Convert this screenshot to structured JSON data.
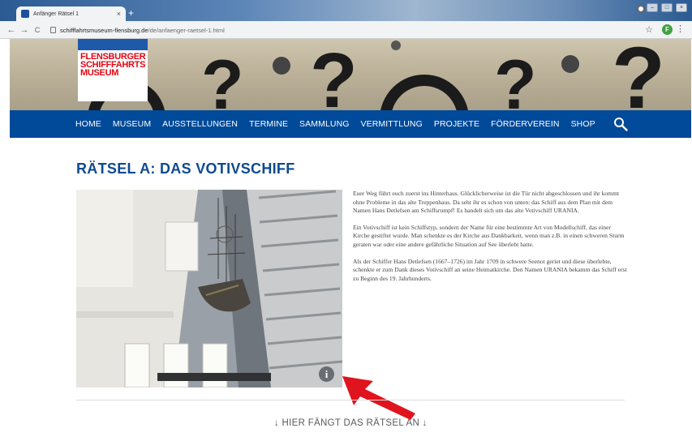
{
  "browser": {
    "tab_title": "Anfänger Rätsel 1",
    "tab_close": "×",
    "new_tab": "+",
    "url_domain": "schifffahrtsmuseum-flensburg.de",
    "url_path": "/de/anfaenger-raetsel-1.html",
    "profile_initial": "F",
    "back": "←",
    "forward": "→",
    "reload": "C",
    "star": "☆",
    "menu": "⋮"
  },
  "logo": {
    "line1": "FLENSBURGER",
    "line2": "SCHIFFFAHRTS",
    "line3": "MUSEUM",
    "brand_red": "#e30613",
    "brand_blue": "#1e5aa8"
  },
  "nav": {
    "items": [
      "HOME",
      "MUSEUM",
      "AUSSTELLUNGEN",
      "TERMINE",
      "SAMMLUNG",
      "VERMITTLUNG",
      "PROJEKTE",
      "FÖRDERVEREIN",
      "SHOP"
    ],
    "background": "#004a99"
  },
  "main": {
    "title": "RÄTSEL A: DAS VOTIVSCHIFF",
    "info_icon": "i",
    "paragraphs": [
      "Euer Weg führt euch zuerst ins Hinterhaus. Glücklicherweise ist die Tür nicht abgeschlossen und ihr kommt ohne Probleme in das alte Treppenhaus. Da seht ihr es schon von unten: das Schiff aus dem Plan mit dem Namen Hans Detlefsen am Schiffsrumpf! Es handelt sich um das alte Votivschiff URANIA.",
      "Ein Votivschiff ist kein Schiffstyp, sondern der Name für eine bestimmte Art von Modellschiff, das einer Kirche gestiftet wurde. Man schenkte es der Kirche aus Dankbarkeit, wenn man z.B. in einen schweren Sturm geraten war oder eine andere gefährliche Situation auf See überlebt hatte.",
      "Als der Schiffer Hans Detlefsen (1667–1726) im Jahr 1709 in schwere Seenot geriet und diese überlebte, schenkte er zum Dank dieses Votivschiff an seine Heimatkirche. Den Namen URANIA bekamm das Schiff erst zu Beginn des 19. Jahrhunderts."
    ],
    "start_hint": "↓ HIER FÄNGT DAS RÄTSEL AN ↓",
    "title_color": "#0e4a91",
    "annotation_color": "#e0141e"
  }
}
